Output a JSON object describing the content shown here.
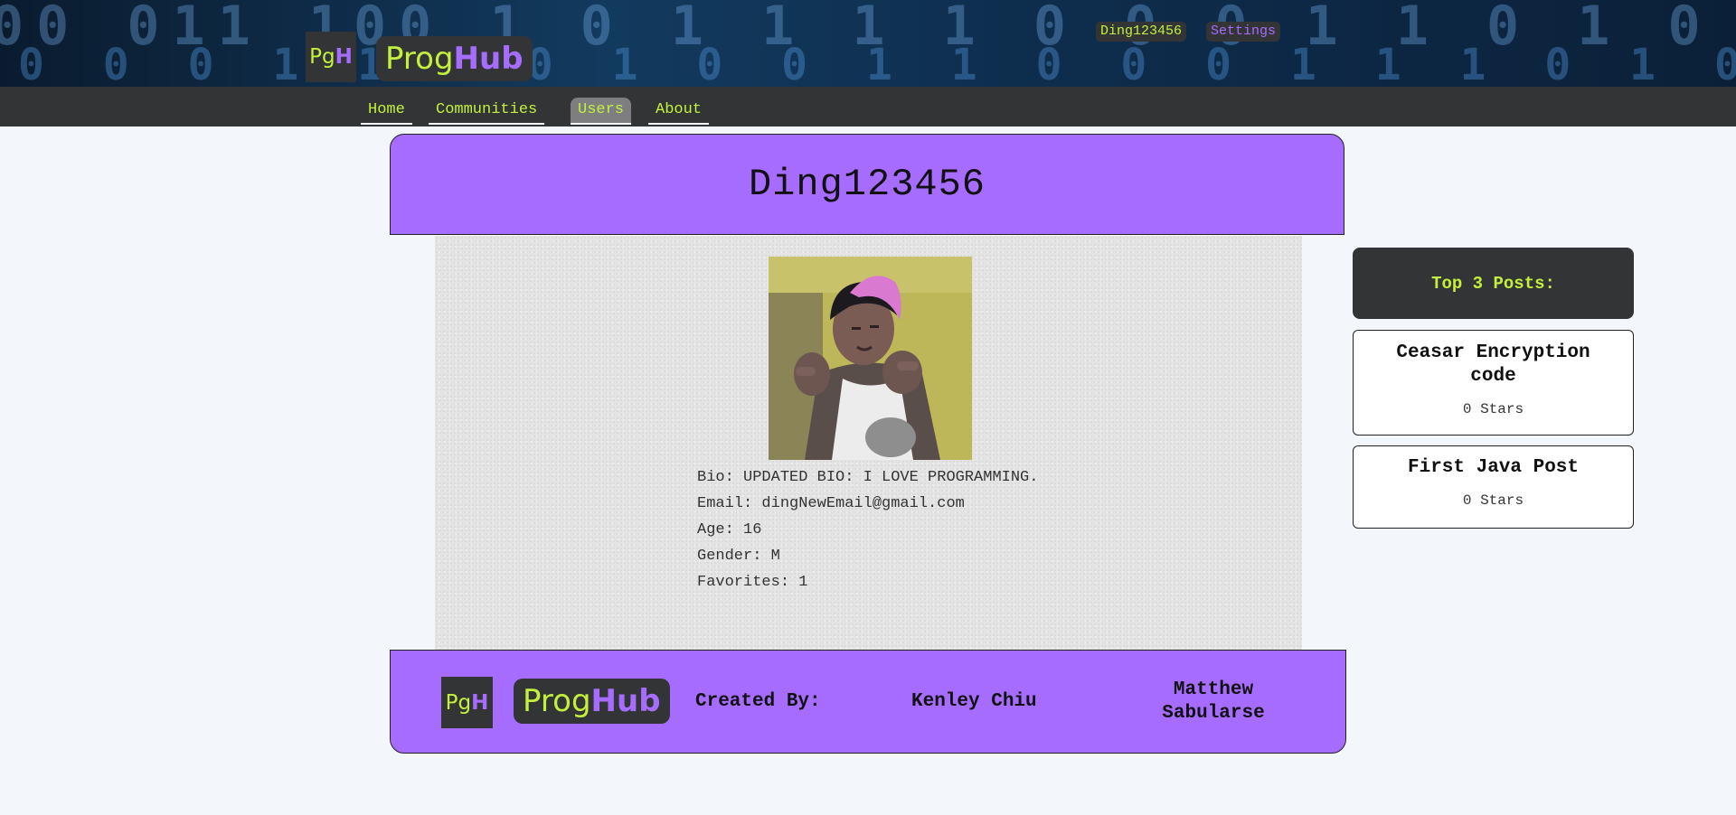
{
  "header": {
    "logo_short_a": "Pg",
    "logo_short_b": "H",
    "logo_word_a": "Prog",
    "logo_word_b": "Hub",
    "binary_row1": "00 011 100 1 0 1 1 1 1 0 0 0 1 1 0 1 0 1 1 0 0 0 1 1 1 0 0 1 1",
    "binary_row2": "0 0 0 1 1 1 0 1 0 0 1 1 0 0 0 1 1 1 0 1 0 0 1 1 1 0 1 0 0 0 1",
    "user_name": "Ding123456",
    "settings_label": "Settings"
  },
  "nav": {
    "items": [
      {
        "label": "Home"
      },
      {
        "label": "Communities"
      },
      {
        "label": "Users"
      },
      {
        "label": "About"
      }
    ],
    "active": "Users"
  },
  "profile": {
    "username": "Ding123456",
    "avatar_alt": "profile photo",
    "bio": "Bio: UPDATED BIO: I LOVE PROGRAMMING.",
    "email": "Email: dingNewEmail@gmail.com",
    "age": "Age: 16",
    "gender": "Gender: M",
    "favorites": "Favorites: 1"
  },
  "top_posts": {
    "heading": "Top 3 Posts:",
    "posts": [
      {
        "title": "Ceasar Encryption code",
        "stars": "0 Stars"
      },
      {
        "title": "First Java Post",
        "stars": "0 Stars"
      }
    ]
  },
  "footer": {
    "created_by": "Created By:",
    "author1": "Kenley Chiu",
    "author2": "Matthew Sabularse"
  },
  "colors": {
    "accent_purple": "#a66cff",
    "accent_green": "#c3f03c",
    "dark": "#333436",
    "page_bg": "#f3f6fb"
  }
}
